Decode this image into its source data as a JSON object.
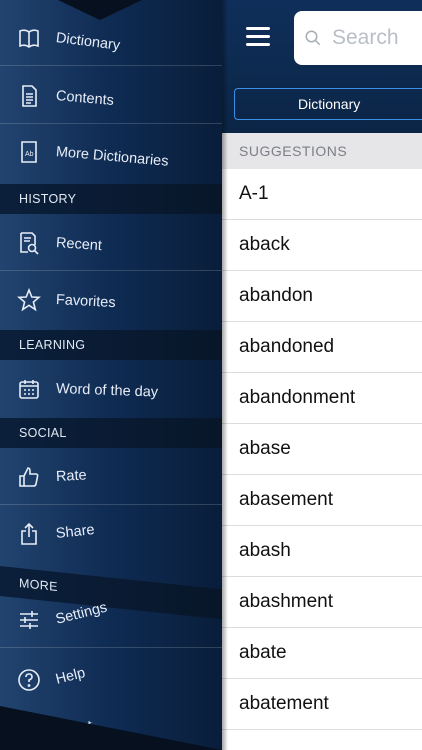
{
  "sidebar": {
    "items": [
      {
        "label": "Dictionary",
        "icon": "book-icon"
      },
      {
        "label": "Contents",
        "icon": "document-icon"
      },
      {
        "label": "More Dictionaries",
        "icon": "dictionary-ab-icon"
      },
      {
        "label": "Recent",
        "icon": "recent-search-icon"
      },
      {
        "label": "Favorites",
        "icon": "star-icon"
      },
      {
        "label": "Word of the day",
        "icon": "calendar-icon"
      },
      {
        "label": "Rate",
        "icon": "thumbs-up-icon"
      },
      {
        "label": "Share",
        "icon": "share-icon"
      },
      {
        "label": "Settings",
        "icon": "sliders-icon"
      },
      {
        "label": "Help",
        "icon": "help-icon"
      },
      {
        "label": "About",
        "icon": "info-icon"
      }
    ],
    "sections": {
      "history": "HISTORY",
      "learning": "LEARNING",
      "social": "SOCIAL",
      "more": "MORE"
    }
  },
  "header": {
    "search_placeholder": "Search",
    "segment_label": "Dictionary"
  },
  "suggestions": {
    "header": "SUGGESTIONS",
    "words": [
      "A-1",
      "aback",
      "abandon",
      "abandoned",
      "abandonment",
      "abase",
      "abasement",
      "abash",
      "abashment",
      "abate",
      "abatement"
    ]
  },
  "colors": {
    "sidebar_bg": "#0f2c54",
    "accent": "#3c8ee6",
    "list_header_bg": "#e6e6e9"
  }
}
